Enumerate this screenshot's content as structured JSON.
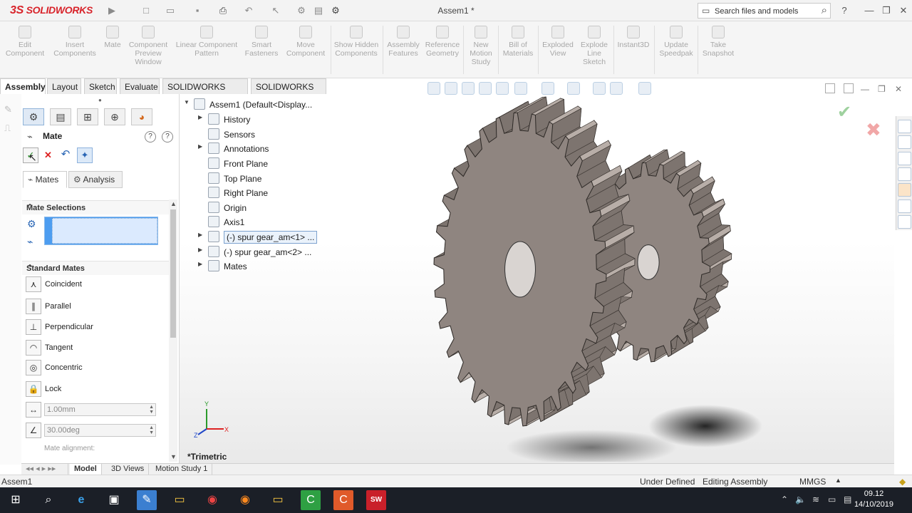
{
  "app": {
    "logo_ds": "3S",
    "logo_text": "SOLIDWORKS",
    "doc_title": "Assem1 *"
  },
  "search": {
    "placeholder": "Search files and models"
  },
  "window_controls": {
    "help": "?",
    "minimize": "—",
    "restore": "❐",
    "close": "✕"
  },
  "command_manager": [
    {
      "name": "edit-component",
      "label": "Edit Component"
    },
    {
      "name": "insert-components",
      "label": "Insert Components"
    },
    {
      "name": "mate",
      "label": "Mate"
    },
    {
      "name": "component-preview-window",
      "label": "Component Preview Window"
    },
    {
      "name": "linear-component-pattern",
      "label": "Linear Component Pattern"
    },
    {
      "name": "smart-fasteners",
      "label": "Smart Fasteners"
    },
    {
      "name": "move-component",
      "label": "Move Component"
    },
    {
      "name": "show-hidden-components",
      "label": "Show Hidden Components"
    },
    {
      "name": "assembly-features",
      "label": "Assembly Features"
    },
    {
      "name": "reference-geometry",
      "label": "Reference Geometry"
    },
    {
      "name": "new-motion-study",
      "label": "New Motion Study"
    },
    {
      "name": "bill-of-materials",
      "label": "Bill of Materials"
    },
    {
      "name": "exploded-view",
      "label": "Exploded View"
    },
    {
      "name": "explode-line-sketch",
      "label": "Explode Line Sketch"
    },
    {
      "name": "instant3d",
      "label": "Instant3D"
    },
    {
      "name": "update-speedpak",
      "label": "Update Speedpak"
    },
    {
      "name": "take-snapshot",
      "label": "Take Snapshot"
    }
  ],
  "tabs": [
    "Assembly",
    "Layout",
    "Sketch",
    "Evaluate",
    "SOLIDWORKS Add-Ins",
    "SOLIDWORKS MBD"
  ],
  "property_manager": {
    "title": "Mate",
    "subtabs": [
      "Mates",
      "Analysis"
    ],
    "mate_selections_label": "Mate Selections",
    "standard_mates_label": "Standard Mates",
    "mates": [
      "Coincident",
      "Parallel",
      "Perpendicular",
      "Tangent",
      "Concentric",
      "Lock"
    ],
    "distance_value": "1.00mm",
    "angle_value": "30.00deg",
    "mate_alignment_label": "Mate alignment:"
  },
  "tree": {
    "root": "Assem1  (Default<Display...",
    "items": [
      "History",
      "Sensors",
      "Annotations",
      "Front Plane",
      "Top Plane",
      "Right Plane",
      "Origin",
      "Axis1",
      "(-) spur gear_am<1> ...",
      "(-) spur gear_am<2> ...",
      "Mates"
    ]
  },
  "viewport": {
    "view_name": "*Trimetric",
    "triad_y": "Y",
    "triad_x": "X",
    "triad_z": "Z"
  },
  "bottom_tabs": [
    "Model",
    "3D Views",
    "Motion Study 1"
  ],
  "status": {
    "doc": "Assem1",
    "state": "Under Defined",
    "mode": "Editing Assembly",
    "units": "MMGS"
  },
  "clock": {
    "time": "09.12",
    "date": "14/10/2019"
  },
  "colors": {
    "gear": "#8f8580",
    "accent": "#d8232a",
    "selection": "#4d9df0"
  }
}
